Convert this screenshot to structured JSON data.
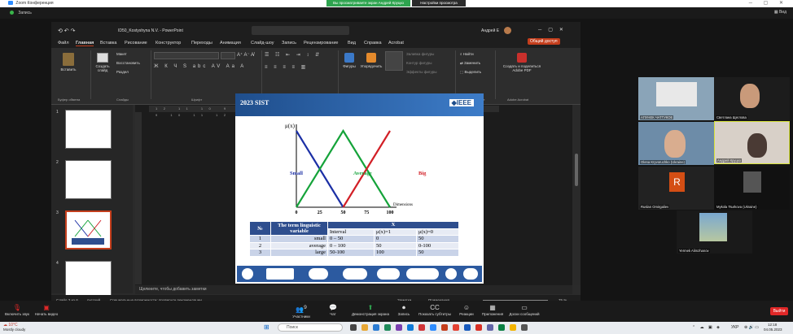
{
  "zoom": {
    "window_title": "Zoom Конференция",
    "share_banner": "Вы просматриваете экран Андрей Круцко",
    "view_options": "Настройки просмотра",
    "recording": "Запись",
    "view_label": "Вид",
    "controls": {
      "mute": "Включить звук",
      "video": "Начать видео",
      "participants": "Участники",
      "participants_count": "9",
      "chat": "Чат",
      "share": "Демонстрация экрана",
      "record": "Запись",
      "captions": "Показать субтитры",
      "reactions": "Реакции",
      "apps": "Приложения",
      "whiteboard": "Доски сообщений",
      "leave": "Выйти"
    }
  },
  "ppt": {
    "file_title": "ID50_Kostyshyna N.V. - PowerPoint",
    "user": "Андрей Е",
    "share_button": "Общий доступ",
    "menu": [
      "Файл",
      "Главная",
      "Вставка",
      "Рисование",
      "Конструктор",
      "Переходы",
      "Анимация",
      "Слайд-шоу",
      "Запись",
      "Рецензирование",
      "Вид",
      "Справка",
      "Acrobat"
    ],
    "ribbon": {
      "paste": "Вставить",
      "clipboard": "Буфер обмена",
      "new_slide": "Создать слайд",
      "layout": "Макет",
      "reset": "Восстановить",
      "section": "Раздел",
      "slides": "Слайды",
      "font": "Шрифт",
      "paragraph": "Абзац",
      "shapes": "Фигуры",
      "arrange": "Упорядочить",
      "shape_fill": "Заливка фигуры",
      "shape_outline": "Контур фигуры",
      "shape_effects": "Эффекты фигуры",
      "drawing": "Рисование",
      "find": "Найти",
      "replace": "Заменить",
      "select": "Выделить",
      "editing": "Редактирование",
      "create_pdf": "Создать и поделиться Adobe PDF",
      "adobe": "Adobe Acrobat"
    },
    "ruler": "12 11 10 9 8 7 6 5 4 3 2 1 0 1 2 3 4 5 6 7 8 9 10 11 12",
    "slide_numbers": [
      "1",
      "2",
      "3",
      "4",
      "5"
    ],
    "notes_placeholder": "Щелкните, чтобы добавить заметки",
    "status": {
      "slide": "Слайд 3 из 6",
      "lang": "русский",
      "access": "Специальные возможности: проверьте рекомендации",
      "notes": "Заметки",
      "comments": "Примечания",
      "zoom": "75 %"
    }
  },
  "slide": {
    "conf": "2023 SIST",
    "ieee": "IEEE",
    "chart_data": {
      "type": "line",
      "ylabel": "μ(x)",
      "xlabel": "Dimensions",
      "xticks": [
        "0",
        "25",
        "50",
        "75",
        "100"
      ],
      "ylim": [
        0,
        1
      ],
      "xlim": [
        0,
        100
      ],
      "series": [
        {
          "name": "Small",
          "color": "#1b2fa5",
          "x": [
            0,
            50
          ],
          "y": [
            1,
            0
          ]
        },
        {
          "name": "Average",
          "color": "#15a33a",
          "x": [
            0,
            50,
            100
          ],
          "y": [
            0,
            1,
            0
          ]
        },
        {
          "name": "Big",
          "color": "#d21f26",
          "x": [
            50,
            100
          ],
          "y": [
            0,
            1
          ]
        }
      ]
    },
    "table": {
      "h_num": "№",
      "h_term": "The term linguistic variable",
      "h_x": "X",
      "sub": [
        "Interval",
        "μ(x)=1",
        "μ(x)=0"
      ],
      "rows": [
        {
          "n": "1",
          "term": "small",
          "interval": "0 – 50",
          "one": "0",
          "zero": "50"
        },
        {
          "n": "2",
          "term": "average",
          "interval": "0 – 100",
          "one": "50",
          "zero": "0-100"
        },
        {
          "n": "3",
          "term": "large",
          "interval": "50-100",
          "one": "100",
          "zero": "50"
        }
      ]
    }
  },
  "participants": [
    {
      "name": "АПУНЕК ЧАТТУКОЕ"
    },
    {
      "name": "Светлана Щеглова"
    },
    {
      "name": "Olena Kryvoruchko (Ukraine)"
    },
    {
      "name": "Андрей Круцко"
    },
    {
      "name": "Ruslan Omirgaliev",
      "initial": "R"
    },
    {
      "name": "Mykola Tsurkova (Ukraine)"
    },
    {
      "name": "Yermek Alimzhanov"
    }
  ],
  "taskbar": {
    "weather_temp": "10°C",
    "weather_desc": "Mostly cloudy",
    "search": "Поиск",
    "lang": "УКР",
    "time": "12:18",
    "date": "04.05.2023"
  }
}
